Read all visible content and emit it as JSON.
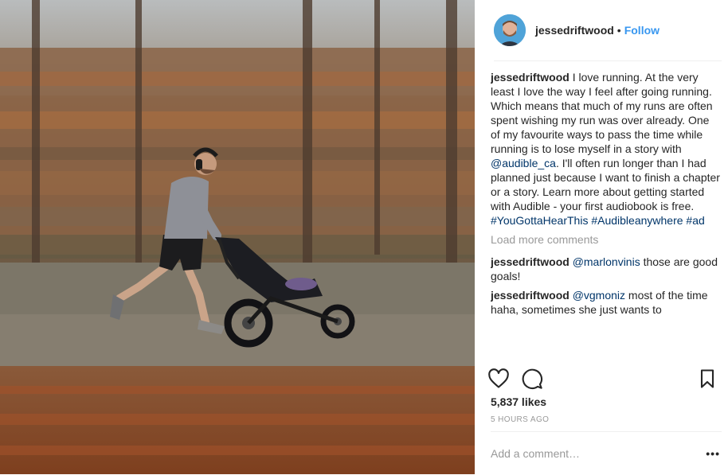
{
  "post": {
    "username": "jessedriftwood",
    "follow_separator": "•",
    "follow_label": "Follow",
    "caption": {
      "username": "jessedriftwood",
      "text": "I love running. At the very least I love the way I feel after going running. Which means that much of my runs are often spent wishing my run was over already. One of my favourite ways to pass the time while running is to lose myself in a story with ",
      "mention": "@audible_ca",
      "text_after": ". I'll often run longer than I had planned just because I want to finish a chapter or a story. Learn more about getting started with Audible - your first audiobook is free.",
      "hashtags": "#YouGottaHearThis #Audibleanywhere #ad"
    },
    "load_more_label": "Load more comments",
    "comments": [
      {
        "username": "jessedriftwood",
        "mention": "@marlonvinis",
        "text": " those are good goals!"
      },
      {
        "username": "jessedriftwood",
        "mention": "@vgmoniz",
        "text": " most of the time haha, sometimes she just wants to"
      }
    ],
    "likes": "5,837 likes",
    "timestamp": "5 HOURS AGO",
    "add_comment_placeholder": "Add a comment…",
    "more_label": "•••",
    "icons": [
      "heart-icon",
      "comment-icon",
      "bookmark-icon",
      "more-icon"
    ]
  }
}
